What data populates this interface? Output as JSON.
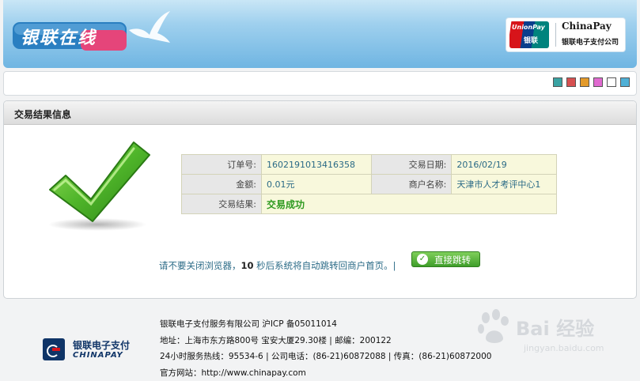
{
  "header": {
    "brand_logo_text": "银联在线",
    "unionpay_en": "UnionPay",
    "unionpay_cn": "银联",
    "chinapay_en": "ChinaPay",
    "chinapay_cn": "银联电子支付公司"
  },
  "swatches": [
    "#3aa3a3",
    "#d65050",
    "#e39a2a",
    "#e06ad0",
    "#ffffff",
    "#4fb0d6"
  ],
  "panel": {
    "title": "交易结果信息",
    "rows": [
      [
        {
          "k": "订单号:",
          "v": "1602191013416358"
        },
        {
          "k": "交易日期:",
          "v": "2016/02/19"
        }
      ],
      [
        {
          "k": "金额:",
          "v": "0.01元"
        },
        {
          "k": "商户名称:",
          "v": "天津市人才考评中心1"
        }
      ]
    ],
    "result_label": "交易结果:",
    "result_value": "交易成功",
    "notice_before": "请不要关闭浏览器，",
    "countdown": "10",
    "notice_after": "秒后系统将自动跳转回商户首页。|",
    "jump_button": "直接跳转"
  },
  "footer": {
    "logo_cn": "银联电子支付",
    "logo_en": "CHINAPAY",
    "line1": "银联电子支付服务有限公司 沪ICP 备05011014",
    "line2": "地址：上海市东方路800号 宝安大厦29.30楼 | 邮编：200122",
    "line3": "24小时服务热线：95534-6 | 公司电话：(86-21)60872088 | 传真：(86-21)60872000",
    "line4": "官方网站：http://www.chinapay.com"
  },
  "watermark": {
    "text": "Bai 经验",
    "sub": "jingyan.baidu.com"
  },
  "colors": {
    "accent_blue": "#2a6a86",
    "success_green": "#2e9a20",
    "header_blue": "#6fb5e2"
  }
}
